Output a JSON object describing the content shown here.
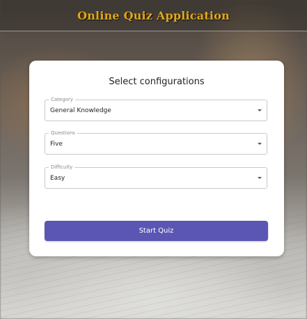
{
  "header": {
    "title": "Online Quiz Application"
  },
  "config": {
    "title": "Select configurations",
    "fields": [
      {
        "label": "Category",
        "value": "General Knowledge",
        "icon": "caret-down-icon"
      },
      {
        "label": "Questions",
        "value": "Five",
        "icon": "caret-down-icon"
      },
      {
        "label": "Difficulty",
        "value": "Easy",
        "icon": "caret-down-icon"
      }
    ],
    "start_label": "Start Quiz"
  },
  "colors": {
    "title_gold": "#e0a81c",
    "button": "#5b56b3"
  }
}
